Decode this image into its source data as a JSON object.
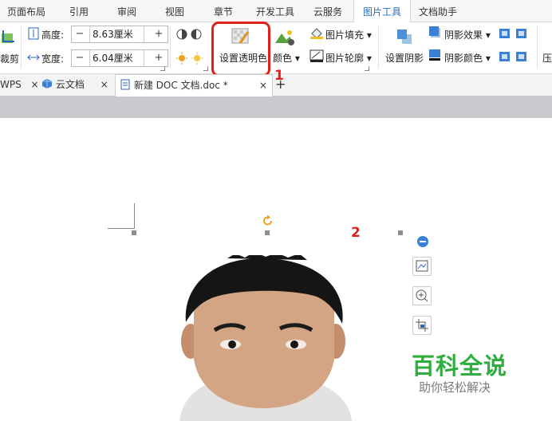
{
  "menu_tabs": [
    "页面布局",
    "引用",
    "审阅",
    "视图",
    "章节",
    "开发工具",
    "云服务",
    "图片工具",
    "文档助手"
  ],
  "active_menu_tab": "图片工具",
  "ribbon": {
    "crop_label": "裁剪",
    "height_label": "高度:",
    "height_value": "8.63厘米",
    "width_label": "宽度:",
    "width_value": "6.04厘米",
    "set_transparent_label": "设置透明色",
    "color_label": "颜色",
    "picture_fill_label": "图片填充",
    "picture_outline_label": "图片轮廓",
    "set_shadow_label": "设置阴影",
    "shadow_effect_label": "阴影效果",
    "shadow_color_label": "阴影颜色",
    "compress_label": "压",
    "minus": "−",
    "plus": "+"
  },
  "annotations": {
    "step1": "1",
    "step2": "2"
  },
  "doc_tabs": [
    {
      "label": "WPS",
      "active": false
    },
    {
      "label": "云文档",
      "active": false
    },
    {
      "label": "新建 DOC 文档.doc *",
      "active": true
    }
  ],
  "doc_tab_close": "×",
  "new_tab": "+",
  "watermark": {
    "title": "百科全说",
    "subtitle": "助你轻松解决"
  },
  "colors": {
    "accent_blue": "#2b6cc4",
    "annotation_red": "#e0201b",
    "watermark_green": "#2fae3f"
  }
}
